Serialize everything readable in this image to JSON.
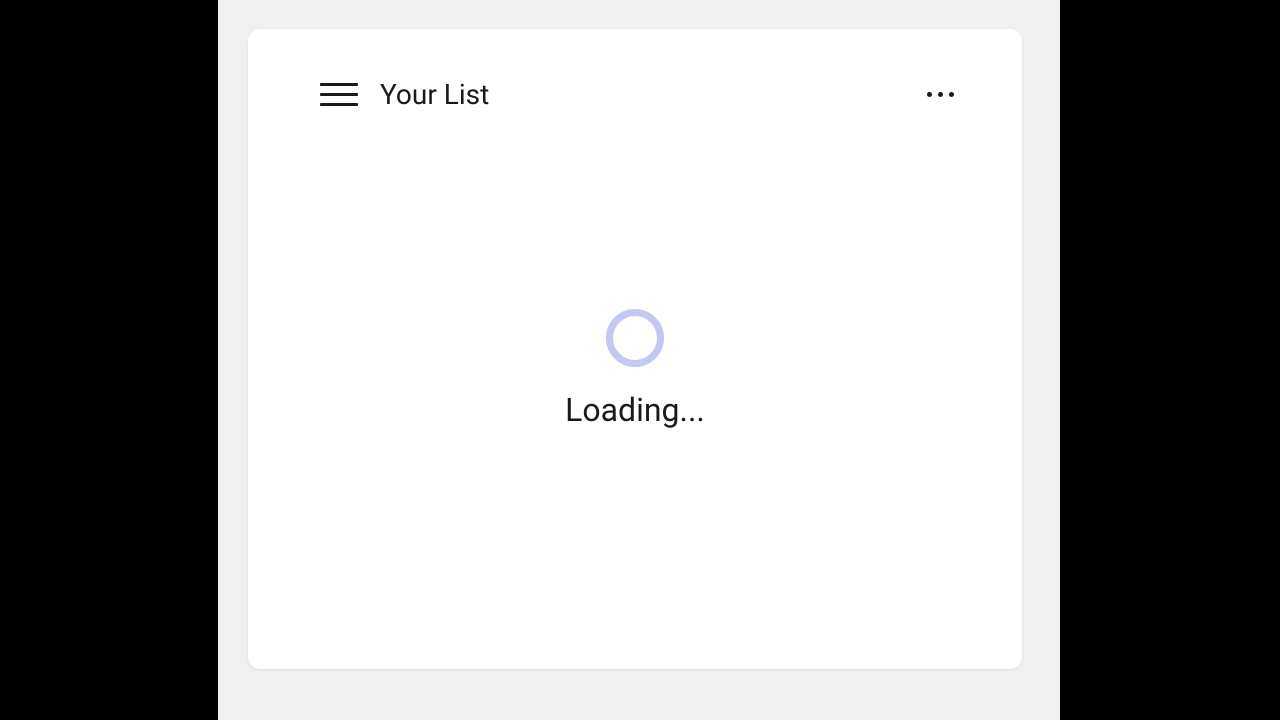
{
  "header": {
    "title": "Your List"
  },
  "content": {
    "loadingText": "Loading..."
  }
}
